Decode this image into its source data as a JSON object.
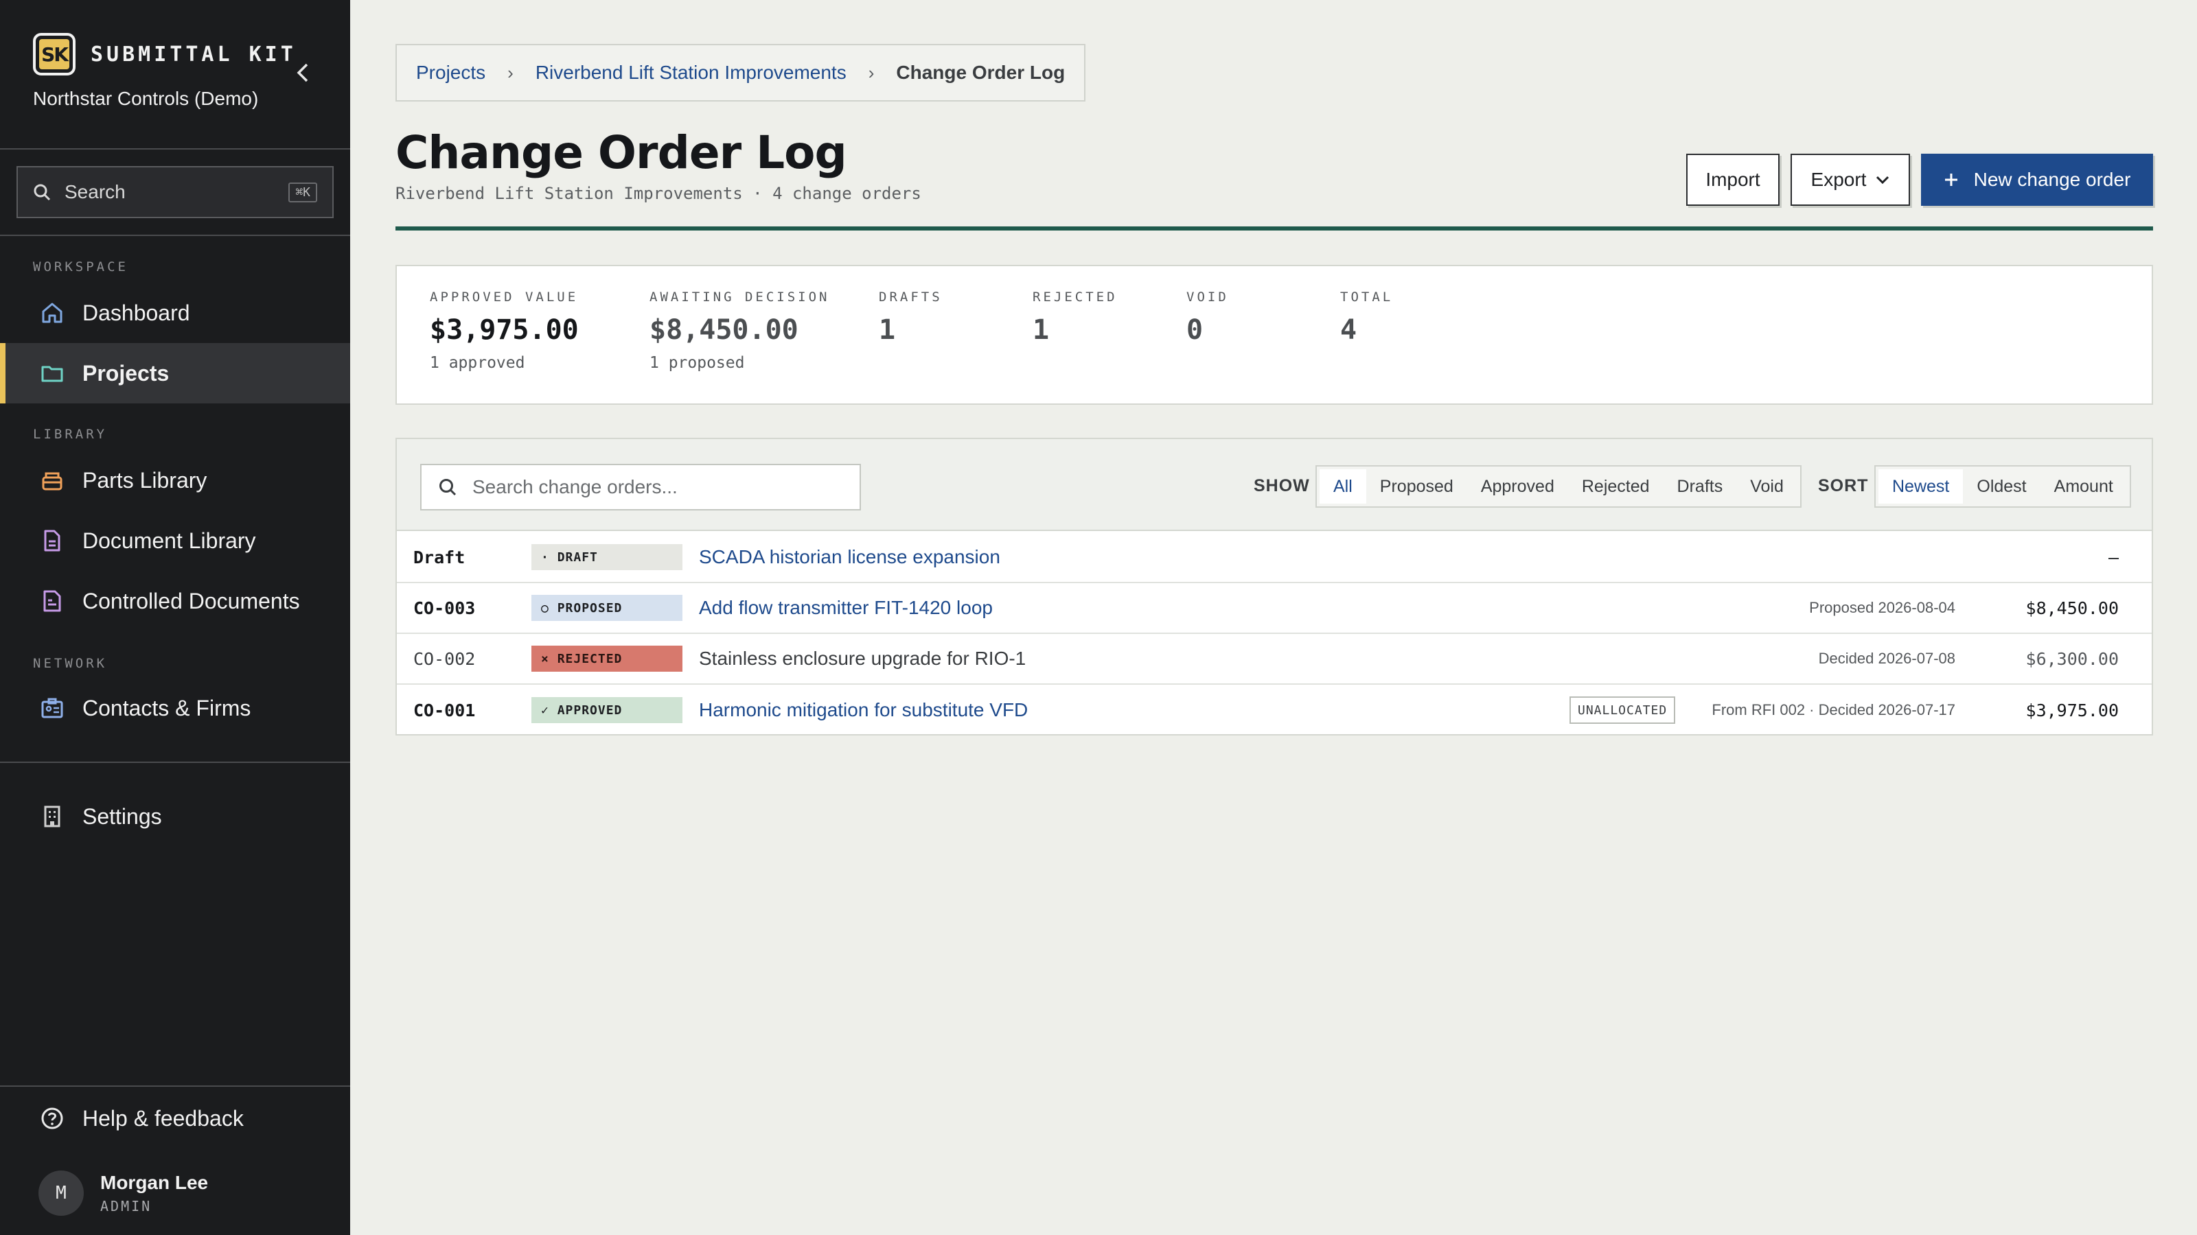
{
  "app": {
    "logo_text": "SK",
    "name": "SUBMITTAL KIT",
    "org": "Northstar Controls (Demo)"
  },
  "sidebar": {
    "search_label": "Search",
    "search_shortcut": "⌘K",
    "sections": {
      "workspace": "WORKSPACE",
      "library": "LIBRARY",
      "network": "NETWORK"
    },
    "items": [
      {
        "label": "Dashboard",
        "icon": "home-icon"
      },
      {
        "label": "Projects",
        "icon": "folder-icon",
        "active": true
      },
      {
        "label": "Parts Library",
        "icon": "box-icon"
      },
      {
        "label": "Document Library",
        "icon": "document-icon"
      },
      {
        "label": "Controlled Documents",
        "icon": "controlled-document-icon"
      },
      {
        "label": "Contacts & Firms",
        "icon": "contacts-icon"
      },
      {
        "label": "Settings",
        "icon": "building-icon"
      }
    ],
    "help_label": "Help & feedback",
    "user": {
      "initial": "M",
      "name": "Morgan Lee",
      "role": "ADMIN"
    }
  },
  "breadcrumb": {
    "items": [
      "Projects",
      "Riverbend Lift Station Improvements"
    ],
    "current": "Change Order Log",
    "separator": "›"
  },
  "page": {
    "title": "Change Order Log",
    "subtitle": "Riverbend Lift Station Improvements · 4 change orders",
    "actions": {
      "import": "Import",
      "export": "Export",
      "new": "New change order"
    }
  },
  "stats": [
    {
      "label": "APPROVED VALUE",
      "value": "$3,975.00",
      "note": "1 approved"
    },
    {
      "label": "AWAITING DECISION",
      "value": "$8,450.00",
      "note": "1 proposed"
    },
    {
      "label": "DRAFTS",
      "value": "1"
    },
    {
      "label": "REJECTED",
      "value": "1"
    },
    {
      "label": "VOID",
      "value": "0"
    },
    {
      "label": "TOTAL",
      "value": "4"
    }
  ],
  "toolbar": {
    "search_placeholder": "Search change orders...",
    "show_label": "SHOW",
    "show_options": [
      "All",
      "Proposed",
      "Approved",
      "Rejected",
      "Drafts",
      "Void"
    ],
    "show_selected": "All",
    "sort_label": "SORT",
    "sort_options": [
      "Newest",
      "Oldest",
      "Amount"
    ],
    "sort_selected": "Newest"
  },
  "change_orders": [
    {
      "number": "Draft",
      "status": "DRAFT",
      "status_icon": "·",
      "title": "SCADA historian license expansion",
      "meta": "",
      "amount": "—"
    },
    {
      "number": "CO-003",
      "status": "PROPOSED",
      "status_icon": "○",
      "title": "Add flow transmitter FIT-1420 loop",
      "meta": "Proposed 2026-08-04",
      "amount": "$8,450.00"
    },
    {
      "number": "CO-002",
      "status": "REJECTED",
      "status_icon": "×",
      "title": "Stainless enclosure upgrade for RIO-1",
      "meta": "Decided 2026-07-08",
      "amount": "$6,300.00"
    },
    {
      "number": "CO-001",
      "status": "APPROVED",
      "status_icon": "✓",
      "title": "Harmonic mitigation for substitute VFD",
      "tag": "UNALLOCATED",
      "meta": "From RFI 002 · Decided 2026-07-17",
      "amount": "$3,975.00"
    }
  ],
  "colors": {
    "sidebar_bg": "#1b1c1e",
    "accent": "#e9c25a",
    "primary": "#1e4a8c",
    "rule": "#1f5a4c",
    "rejected": "#d7796d"
  }
}
